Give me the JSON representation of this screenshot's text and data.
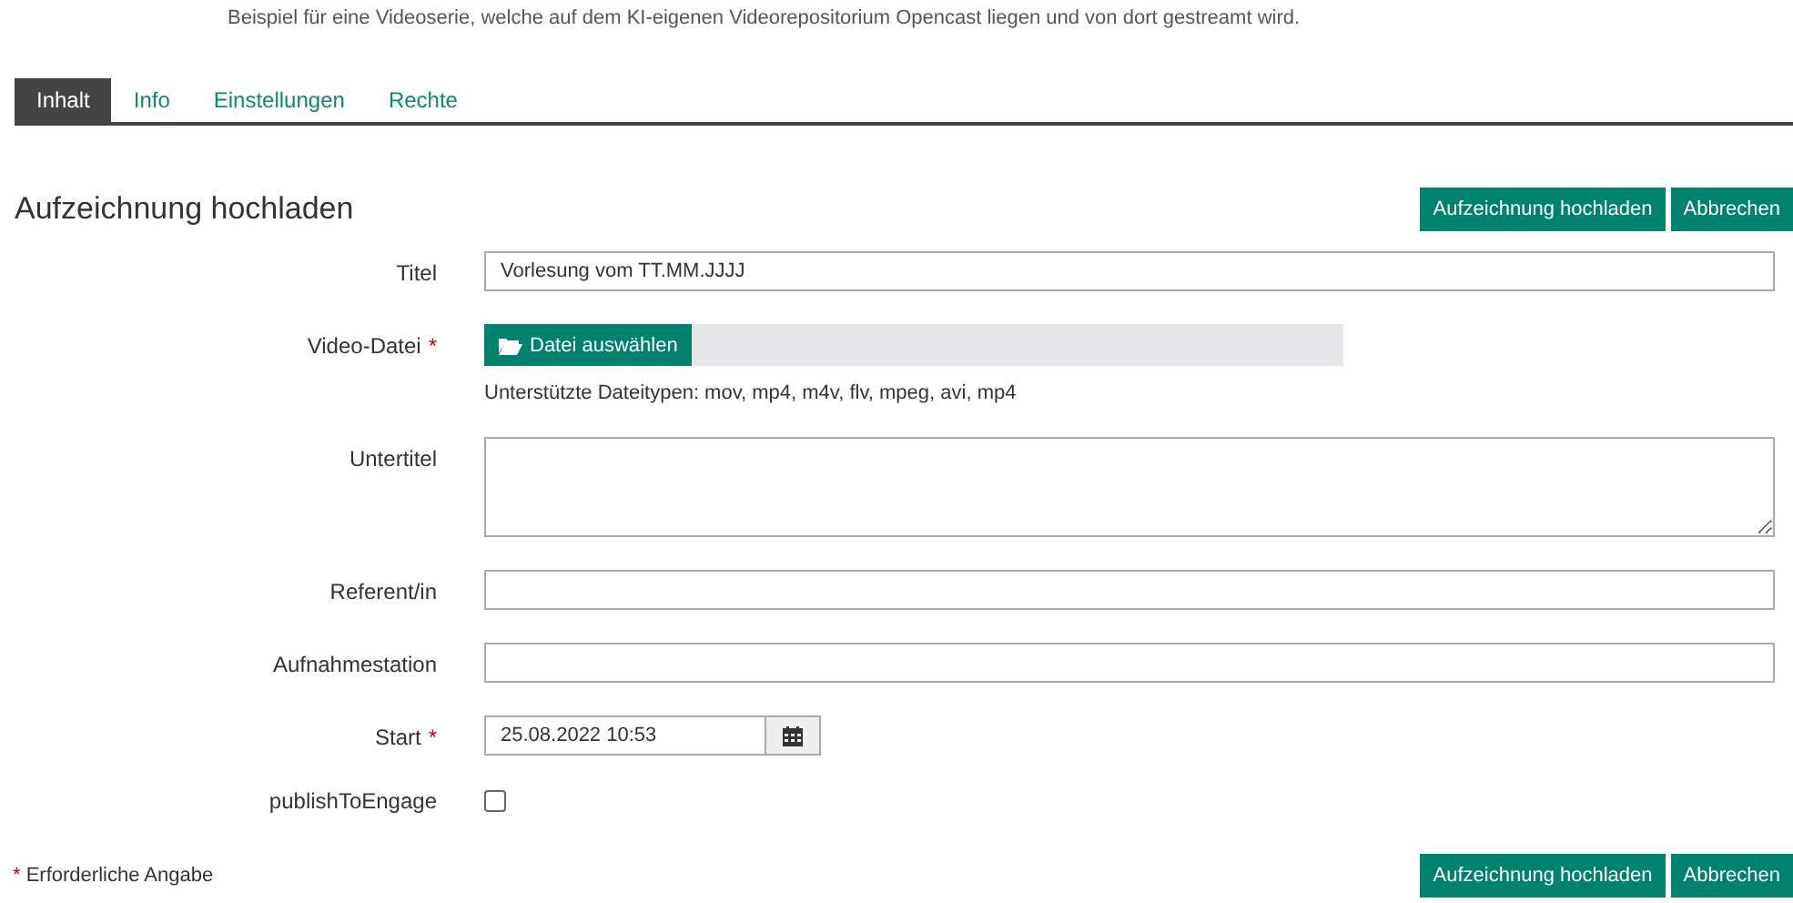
{
  "description": "Beispiel für eine Videoserie, welche auf dem KI-eigenen Videorepositorium Opencast liegen und von dort gestreamt wird.",
  "tabs": [
    {
      "label": "Inhalt",
      "selected": true
    },
    {
      "label": "Info",
      "selected": false
    },
    {
      "label": "Einstellungen",
      "selected": false
    },
    {
      "label": "Rechte",
      "selected": false
    }
  ],
  "heading": "Aufzeichnung hochladen",
  "buttons": [
    "Aufzeichnung hochladen",
    "Abbrechen"
  ],
  "fields": [
    {
      "kind": "text",
      "label": "Titel",
      "value": "Vorlesung vom TT.MM.JJJJ"
    },
    {
      "kind": "file",
      "label": "Video-Datei",
      "required_mark": "*",
      "button": "Datei auswählen",
      "hint": "Unterstützte Dateitypen: mov, mp4, m4v, flv, mpeg, avi, mp4"
    },
    {
      "kind": "textarea",
      "label": "Untertitel"
    },
    {
      "kind": "text",
      "label": "Referent/in"
    },
    {
      "kind": "text",
      "label": "Aufnahmestation"
    },
    {
      "kind": "datetime",
      "label": "Start",
      "required_mark": "*",
      "value": "25.08.2022 10:53"
    },
    {
      "kind": "checkbox",
      "label": "publishToEngage",
      "checked": false
    }
  ],
  "required_note": {
    "mark": "*",
    "text": "Erforderliche Angabe"
  },
  "footer_buttons": [
    "Aufzeichnung hochladen",
    "Abbrechen"
  ]
}
